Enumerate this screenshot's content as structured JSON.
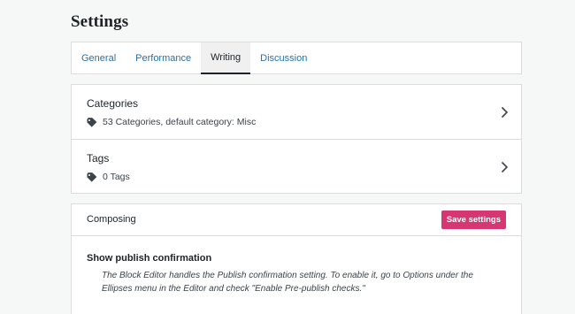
{
  "page": {
    "title": "Settings"
  },
  "tabs": [
    {
      "label": "General",
      "active": false
    },
    {
      "label": "Performance",
      "active": false
    },
    {
      "label": "Writing",
      "active": true
    },
    {
      "label": "Discussion",
      "active": false
    }
  ],
  "taxonomies": {
    "categories": {
      "title": "Categories",
      "summary": "53 Categories, default category: Misc"
    },
    "tags": {
      "title": "Tags",
      "summary": "0 Tags"
    }
  },
  "composing": {
    "title": "Composing",
    "save_label": "Save settings",
    "setting": {
      "title": "Show publish confirmation",
      "description": "The Block Editor handles the Publish confirmation setting. To enable it, go to Options under the Ellipses menu in the Editor and check \"Enable Pre-publish checks.\""
    }
  },
  "colors": {
    "accent": "#2271b1",
    "primary_button": "#d63672",
    "text": "#1d2327",
    "background": "#f6f7f7"
  },
  "icons": {
    "tag": "tag-icon",
    "chevron": "chevron-right-icon"
  }
}
